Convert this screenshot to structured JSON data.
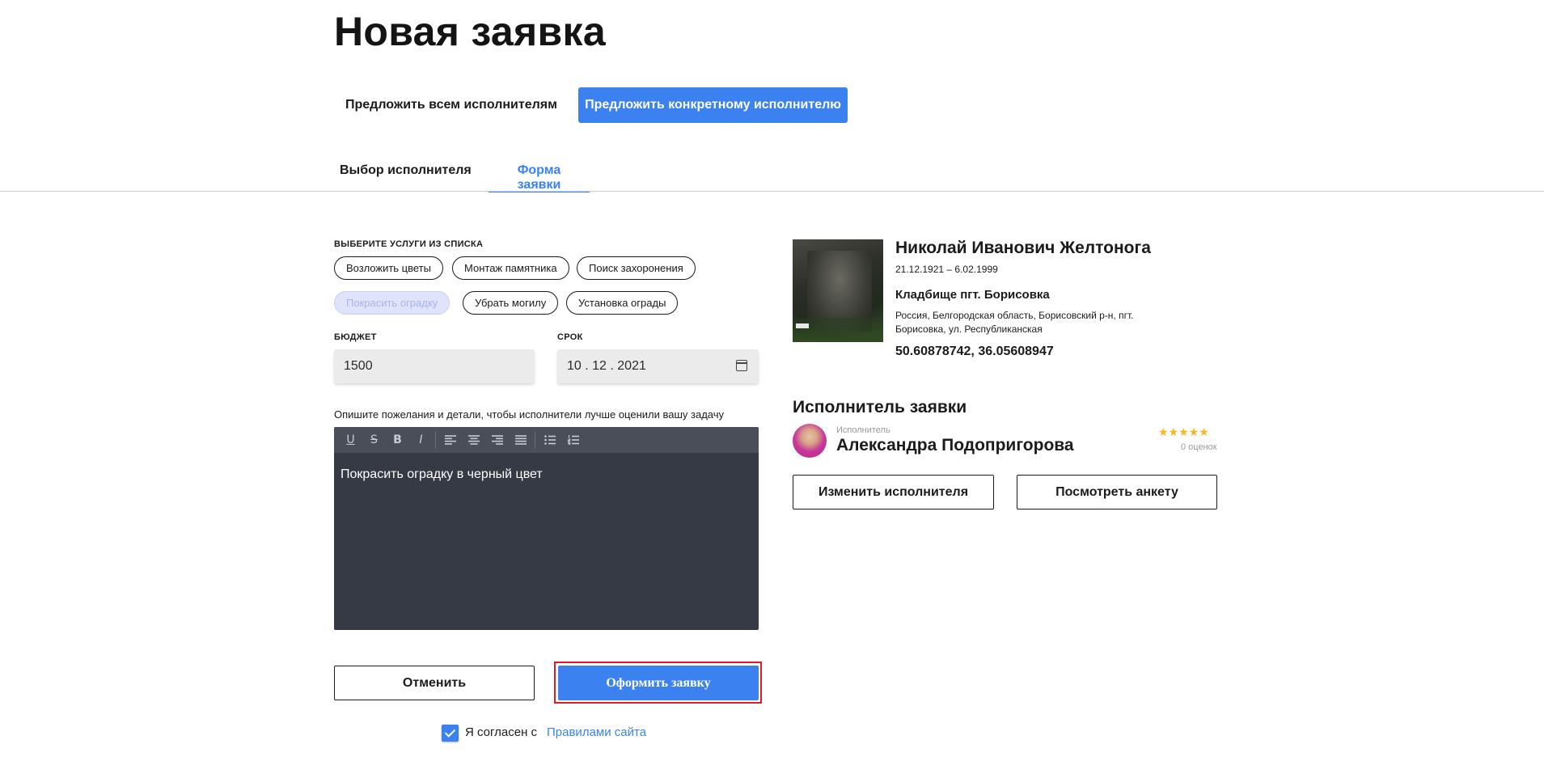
{
  "page": {
    "title": "Новая заявка"
  },
  "mode": {
    "all_label": "Предложить всем исполнителям",
    "specific_label": "Предложить конкретному исполнителю"
  },
  "tabs": [
    {
      "label": "Выбор исполнителя"
    },
    {
      "label": "Форма заявки",
      "active": true
    }
  ],
  "services": {
    "label": "ВЫБЕРИТЕ УСЛУГИ ИЗ СПИСКА",
    "items": [
      {
        "label": "Возложить цветы",
        "selected": false
      },
      {
        "label": "Монтаж памятника",
        "selected": false
      },
      {
        "label": "Поиск захоронения",
        "selected": false
      },
      {
        "label": "Покрасить оградку",
        "selected": true
      },
      {
        "label": "Убрать могилу",
        "selected": false
      },
      {
        "label": "Установка ограды",
        "selected": false
      }
    ]
  },
  "budget": {
    "label": "БЮДЖЕТ",
    "value": "1500"
  },
  "deadline": {
    "label": "СРОК",
    "value": "10 . 12 . 2021",
    "icon": "calendar-icon"
  },
  "description": {
    "label": "Опишите пожелания и детали, чтобы исполнители лучше оценили вашу задачу",
    "text": "Покрасить оградку в черный цвет",
    "toolbar": [
      "U",
      "S",
      "B",
      "I"
    ]
  },
  "actions": {
    "cancel_label": "Отменить",
    "submit_label": "Оформить заявку"
  },
  "agreement": {
    "text": "Я согласен с",
    "link": "Правилами сайта",
    "checked": true
  },
  "deceased": {
    "name": "Николай Иванович Желтонога",
    "dates": "21.12.1921 – 6.02.1999",
    "cemetery": "Кладбище пгт. Борисовка",
    "address": "Россия, Белгородская область, Борисовский р-н, пгт. Борисовка, ул. Республиканская",
    "coords": "50.60878742, 36.05608947"
  },
  "executor": {
    "section_title": "Исполнитель заявки",
    "role": "Исполнитель",
    "name": "Александра Подопригорова",
    "stars": "★★★★★",
    "ratings": "0 оценок",
    "change_label": "Изменить исполнителя",
    "view_label": "Посмотреть анкету"
  },
  "colors": {
    "accent": "#3b82f0",
    "editor_bg": "#363a45",
    "highlight": "#e01b24",
    "star": "#f5b820"
  }
}
